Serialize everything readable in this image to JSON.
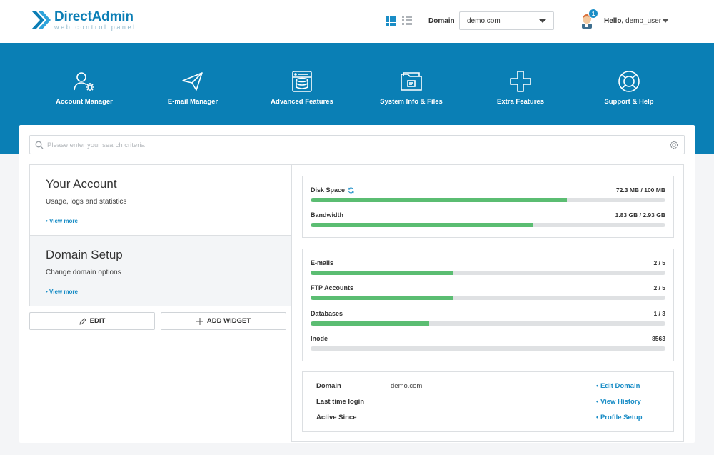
{
  "brand": {
    "title": "DirectAdmin",
    "subtitle": "web control panel",
    "color": "#0b7eb5"
  },
  "header": {
    "view_grid_icon": "grid-view-icon",
    "view_list_icon": "list-view-icon",
    "domain_label": "Domain",
    "domain_selected": "demo.com",
    "notification_count": "1",
    "greeting": "Hello,",
    "username": "demo_user"
  },
  "menu": [
    {
      "label": "Account Manager",
      "icon": "account-manager-icon"
    },
    {
      "label": "E-mail Manager",
      "icon": "paper-plane-icon"
    },
    {
      "label": "Advanced Features",
      "icon": "server-icon"
    },
    {
      "label": "System Info & Files",
      "icon": "folder-icon"
    },
    {
      "label": "Extra Features",
      "icon": "plus-icon"
    },
    {
      "label": "Support & Help",
      "icon": "lifebuoy-icon"
    }
  ],
  "search": {
    "placeholder": "Please enter your search criteria",
    "value": ""
  },
  "widgets": {
    "account": {
      "title": "Your Account",
      "subtitle": "Usage, logs and statistics",
      "link": "• View more"
    },
    "domain": {
      "title": "Domain Setup",
      "subtitle": "Change domain options",
      "link": "• View more"
    },
    "edit_label": "EDIT",
    "add_widget_label": "ADD WIDGET"
  },
  "usage": [
    {
      "label": "Disk Space",
      "value": "72.3 MB / 100 MB",
      "percent": 72.3
    },
    {
      "label": "Bandwidth",
      "value": "1.83 GB / 2.93 GB",
      "percent": 62.5
    }
  ],
  "limits": [
    {
      "label": "E-mails",
      "value": "2 / 5",
      "percent": 40
    },
    {
      "label": "FTP Accounts",
      "value": "2 / 5",
      "percent": 40
    },
    {
      "label": "Databases",
      "value": "1 / 3",
      "percent": 33.3
    },
    {
      "label": "Inode",
      "value": "8563",
      "percent": 0
    }
  ],
  "info": [
    {
      "key": "Domain",
      "value": "demo.com",
      "link": "• Edit Domain"
    },
    {
      "key": "Last time login",
      "value": "",
      "link": "• View History"
    },
    {
      "key": "Active Since",
      "value": "",
      "link": "• Profile Setup"
    }
  ],
  "colors": {
    "band": "#0a7fb5",
    "accent": "#1a8dc6",
    "bar_fill": "#5bbd72",
    "bar_track": "#dfe1e3"
  }
}
